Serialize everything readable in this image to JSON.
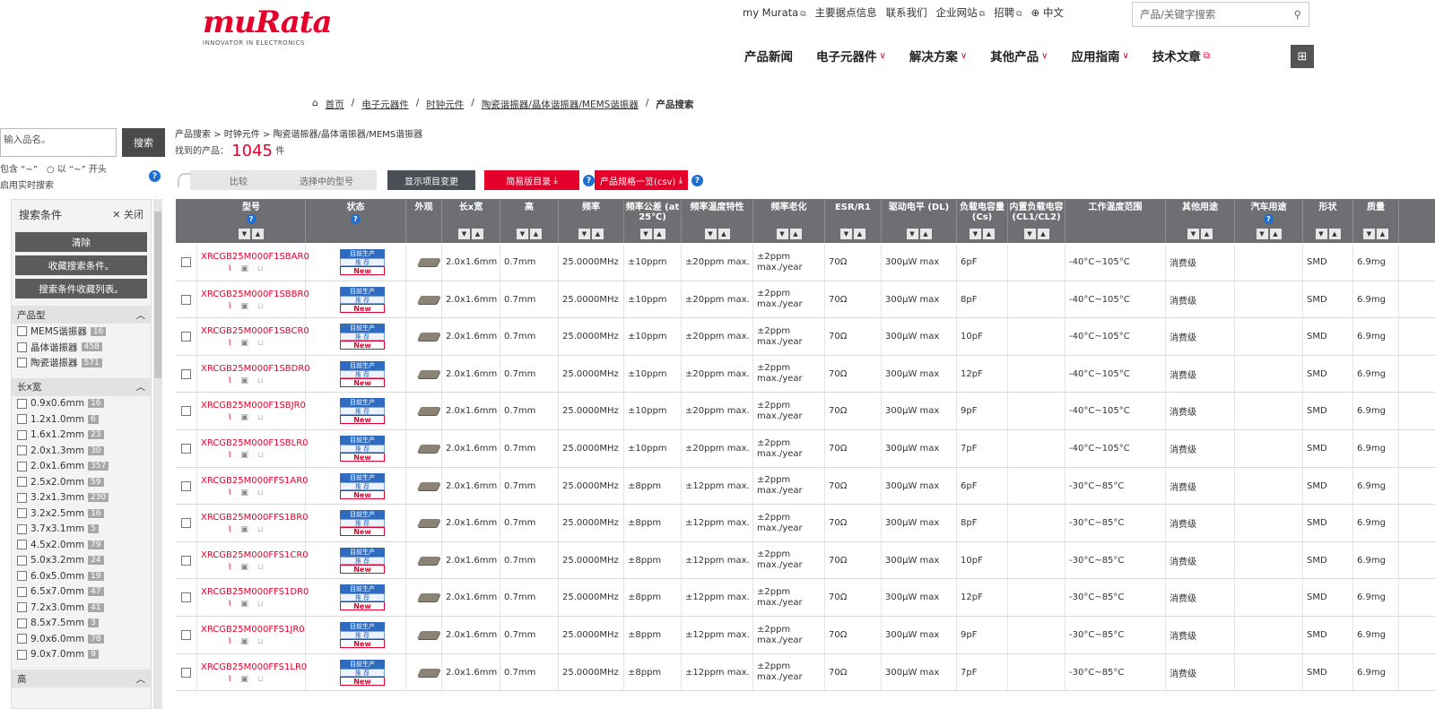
{
  "header": {
    "logo_text": "muRata",
    "logo_tagline": "INNOVATOR IN ELECTRONICS",
    "util_links": [
      {
        "label": "my Murata",
        "ext": true
      },
      {
        "label": "主要据点信息",
        "ext": false
      },
      {
        "label": "联系我们",
        "ext": false
      },
      {
        "label": "企业网站",
        "ext": true
      },
      {
        "label": "招聘",
        "ext": true
      }
    ],
    "language": "中文",
    "search_placeholder": "产品/关键字搜索",
    "main_nav": [
      {
        "label": "产品新闻",
        "chevron": false,
        "ext": false
      },
      {
        "label": "电子元器件",
        "chevron": true,
        "ext": false
      },
      {
        "label": "解决方案",
        "chevron": true,
        "ext": false
      },
      {
        "label": "其他产品",
        "chevron": true,
        "ext": false
      },
      {
        "label": "应用指南",
        "chevron": true,
        "ext": false
      },
      {
        "label": "技术文章",
        "chevron": false,
        "ext": true
      }
    ]
  },
  "breadcrumb": {
    "items": [
      "首页",
      "电子元器件",
      "时钟元件",
      "陶瓷谐振器/晶体谐振器/MEMS谐振器"
    ],
    "current": "产品搜索"
  },
  "sidebar": {
    "search_placeholder": "输入品名。",
    "search_button": "搜索",
    "option_contains": "包含 “~”",
    "option_starts": "以 “~” 开头",
    "realtime": "启用实时搜索",
    "panel_title": "搜索条件",
    "close_label": "关闭",
    "buttons": [
      "清除",
      "收藏搜索条件。",
      "搜索条件收藏列表。"
    ],
    "groups": [
      {
        "title": "产品型",
        "items": [
          {
            "label": "MEMS谐振器",
            "count": "16"
          },
          {
            "label": "晶体谐振器",
            "count": "458"
          },
          {
            "label": "陶瓷谐振器",
            "count": "571"
          }
        ]
      },
      {
        "title": "长x宽",
        "items": [
          {
            "label": "0.9x0.6mm",
            "count": "16"
          },
          {
            "label": "1.2x1.0mm",
            "count": "6"
          },
          {
            "label": "1.6x1.2mm",
            "count": "23"
          },
          {
            "label": "2.0x1.3mm",
            "count": "30"
          },
          {
            "label": "2.0x1.6mm",
            "count": "357"
          },
          {
            "label": "2.5x2.0mm",
            "count": "59"
          },
          {
            "label": "3.2x1.3mm",
            "count": "230"
          },
          {
            "label": "3.2x2.5mm",
            "count": "16"
          },
          {
            "label": "3.7x3.1mm",
            "count": "5"
          },
          {
            "label": "4.5x2.0mm",
            "count": "79"
          },
          {
            "label": "5.0x3.2mm",
            "count": "24"
          },
          {
            "label": "6.0x5.0mm",
            "count": "19"
          },
          {
            "label": "6.5x7.0mm",
            "count": "47"
          },
          {
            "label": "7.2x3.0mm",
            "count": "41"
          },
          {
            "label": "8.5x7.5mm",
            "count": "3"
          },
          {
            "label": "9.0x6.0mm",
            "count": "78"
          },
          {
            "label": "9.0x7.0mm",
            "count": "9"
          }
        ]
      },
      {
        "title": "高",
        "items": []
      }
    ]
  },
  "results": {
    "path": "产品搜索 > 时钟元件 > 陶瓷谐振器/晶体谐振器/MEMS谐振器",
    "found_label": "找到的产品：",
    "found_count": "1045",
    "found_unit": "件",
    "toolbar": {
      "compare": "比较",
      "selected_models": "选择中的型号",
      "display_change": "显示项目变更",
      "simple_catalog": "简易版目录",
      "spec_csv": "产品规格一览(csv)"
    }
  },
  "table": {
    "columns": [
      "型号",
      "状态",
      "外观",
      "长x宽",
      "高",
      "频率",
      "频率公差 (at 25℃)",
      "频率温度特性",
      "频率老化",
      "ESR/R1",
      "驱动电平 (DL)",
      "负载电容量 (Cs)",
      "内置负载电容 (CL1/CL2)",
      "工作温度范围",
      "其他用途",
      "汽车用途",
      "形状",
      "质量"
    ],
    "status_labels": [
      "目前生产",
      "推 荐",
      "New"
    ],
    "rows": [
      {
        "part": "XRCGB25M000F1SBAR0",
        "size": "2.0x1.6mm",
        "height": "0.7mm",
        "freq": "25.0000MHz",
        "tol": "±10ppm",
        "temp": "±20ppm max.",
        "aging": "±2ppm max./year",
        "esr": "70Ω",
        "drive": "300μW max",
        "load": "6pF",
        "builtin": "",
        "range": "-40°C~105°C",
        "use": "消费级",
        "auto": "",
        "shape": "SMD",
        "mass": "6.9mg"
      },
      {
        "part": "XRCGB25M000F1SBBR0",
        "size": "2.0x1.6mm",
        "height": "0.7mm",
        "freq": "25.0000MHz",
        "tol": "±10ppm",
        "temp": "±20ppm max.",
        "aging": "±2ppm max./year",
        "esr": "70Ω",
        "drive": "300μW max",
        "load": "8pF",
        "builtin": "",
        "range": "-40°C~105°C",
        "use": "消费级",
        "auto": "",
        "shape": "SMD",
        "mass": "6.9mg"
      },
      {
        "part": "XRCGB25M000F1SBCR0",
        "size": "2.0x1.6mm",
        "height": "0.7mm",
        "freq": "25.0000MHz",
        "tol": "±10ppm",
        "temp": "±20ppm max.",
        "aging": "±2ppm max./year",
        "esr": "70Ω",
        "drive": "300μW max",
        "load": "10pF",
        "builtin": "",
        "range": "-40°C~105°C",
        "use": "消费级",
        "auto": "",
        "shape": "SMD",
        "mass": "6.9mg"
      },
      {
        "part": "XRCGB25M000F1SBDR0",
        "size": "2.0x1.6mm",
        "height": "0.7mm",
        "freq": "25.0000MHz",
        "tol": "±10ppm",
        "temp": "±20ppm max.",
        "aging": "±2ppm max./year",
        "esr": "70Ω",
        "drive": "300μW max",
        "load": "12pF",
        "builtin": "",
        "range": "-40°C~105°C",
        "use": "消费级",
        "auto": "",
        "shape": "SMD",
        "mass": "6.9mg"
      },
      {
        "part": "XRCGB25M000F1SBJR0",
        "size": "2.0x1.6mm",
        "height": "0.7mm",
        "freq": "25.0000MHz",
        "tol": "±10ppm",
        "temp": "±20ppm max.",
        "aging": "±2ppm max./year",
        "esr": "70Ω",
        "drive": "300μW max",
        "load": "9pF",
        "builtin": "",
        "range": "-40°C~105°C",
        "use": "消费级",
        "auto": "",
        "shape": "SMD",
        "mass": "6.9mg"
      },
      {
        "part": "XRCGB25M000F1SBLR0",
        "size": "2.0x1.6mm",
        "height": "0.7mm",
        "freq": "25.0000MHz",
        "tol": "±10ppm",
        "temp": "±20ppm max.",
        "aging": "±2ppm max./year",
        "esr": "70Ω",
        "drive": "300μW max",
        "load": "7pF",
        "builtin": "",
        "range": "-40°C~105°C",
        "use": "消费级",
        "auto": "",
        "shape": "SMD",
        "mass": "6.9mg"
      },
      {
        "part": "XRCGB25M000FFS1AR0",
        "size": "2.0x1.6mm",
        "height": "0.7mm",
        "freq": "25.0000MHz",
        "tol": "±8ppm",
        "temp": "±12ppm max.",
        "aging": "±2ppm max./year",
        "esr": "70Ω",
        "drive": "300μW max",
        "load": "6pF",
        "builtin": "",
        "range": "-30°C~85°C",
        "use": "消费级",
        "auto": "",
        "shape": "SMD",
        "mass": "6.9mg"
      },
      {
        "part": "XRCGB25M000FFS1BR0",
        "size": "2.0x1.6mm",
        "height": "0.7mm",
        "freq": "25.0000MHz",
        "tol": "±8ppm",
        "temp": "±12ppm max.",
        "aging": "±2ppm max./year",
        "esr": "70Ω",
        "drive": "300μW max",
        "load": "8pF",
        "builtin": "",
        "range": "-30°C~85°C",
        "use": "消费级",
        "auto": "",
        "shape": "SMD",
        "mass": "6.9mg"
      },
      {
        "part": "XRCGB25M000FFS1CR0",
        "size": "2.0x1.6mm",
        "height": "0.7mm",
        "freq": "25.0000MHz",
        "tol": "±8ppm",
        "temp": "±12ppm max.",
        "aging": "±2ppm max./year",
        "esr": "70Ω",
        "drive": "300μW max",
        "load": "10pF",
        "builtin": "",
        "range": "-30°C~85°C",
        "use": "消费级",
        "auto": "",
        "shape": "SMD",
        "mass": "6.9mg"
      },
      {
        "part": "XRCGB25M000FFS1DR0",
        "size": "2.0x1.6mm",
        "height": "0.7mm",
        "freq": "25.0000MHz",
        "tol": "±8ppm",
        "temp": "±12ppm max.",
        "aging": "±2ppm max./year",
        "esr": "70Ω",
        "drive": "300μW max",
        "load": "12pF",
        "builtin": "",
        "range": "-30°C~85°C",
        "use": "消费级",
        "auto": "",
        "shape": "SMD",
        "mass": "6.9mg"
      },
      {
        "part": "XRCGB25M000FFS1JR0",
        "size": "2.0x1.6mm",
        "height": "0.7mm",
        "freq": "25.0000MHz",
        "tol": "±8ppm",
        "temp": "±12ppm max.",
        "aging": "±2ppm max./year",
        "esr": "70Ω",
        "drive": "300μW max",
        "load": "9pF",
        "builtin": "",
        "range": "-30°C~85°C",
        "use": "消费级",
        "auto": "",
        "shape": "SMD",
        "mass": "6.9mg"
      },
      {
        "part": "XRCGB25M000FFS1LR0",
        "size": "2.0x1.6mm",
        "height": "0.7mm",
        "freq": "25.0000MHz",
        "tol": "±8ppm",
        "temp": "±12ppm max.",
        "aging": "±2ppm max./year",
        "esr": "70Ω",
        "drive": "300μW max",
        "load": "7pF",
        "builtin": "",
        "range": "-30°C~85°C",
        "use": "消费级",
        "auto": "",
        "shape": "SMD",
        "mass": "6.9mg"
      }
    ]
  }
}
